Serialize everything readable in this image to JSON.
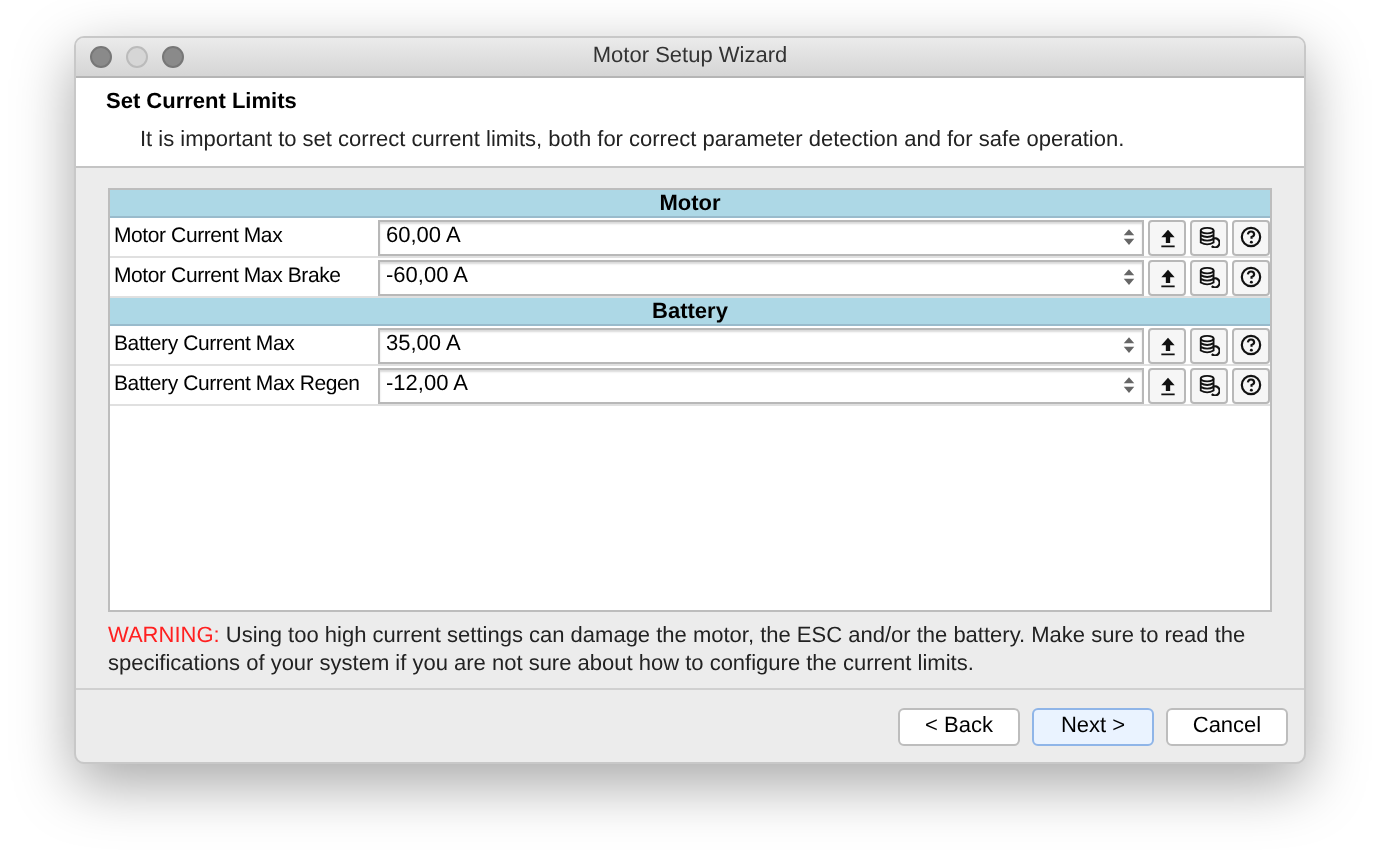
{
  "window": {
    "title": "Motor Setup Wizard"
  },
  "header": {
    "title": "Set Current Limits",
    "subtitle": "It is important to set correct current limits, both for correct parameter detection and for safe operation."
  },
  "sections": [
    {
      "title": "Motor",
      "params": [
        {
          "label": "Motor Current Max",
          "value": "60,00 A"
        },
        {
          "label": "Motor Current Max Brake",
          "value": "-60,00 A"
        }
      ]
    },
    {
      "title": "Battery",
      "params": [
        {
          "label": "Battery Current Max",
          "value": "35,00 A"
        },
        {
          "label": "Battery Current Max Regen",
          "value": "-12,00 A"
        }
      ]
    }
  ],
  "warning": {
    "prefix": "WARNING:",
    "text": "Using too high current settings can damage the motor, the ESC and/or the battery. Make sure to read the specifications of your system if you are not sure about how to configure the current limits."
  },
  "buttons": [
    {
      "label": "< Back",
      "default": false
    },
    {
      "label": "Next >",
      "default": true
    },
    {
      "label": "Cancel",
      "default": false
    }
  ]
}
